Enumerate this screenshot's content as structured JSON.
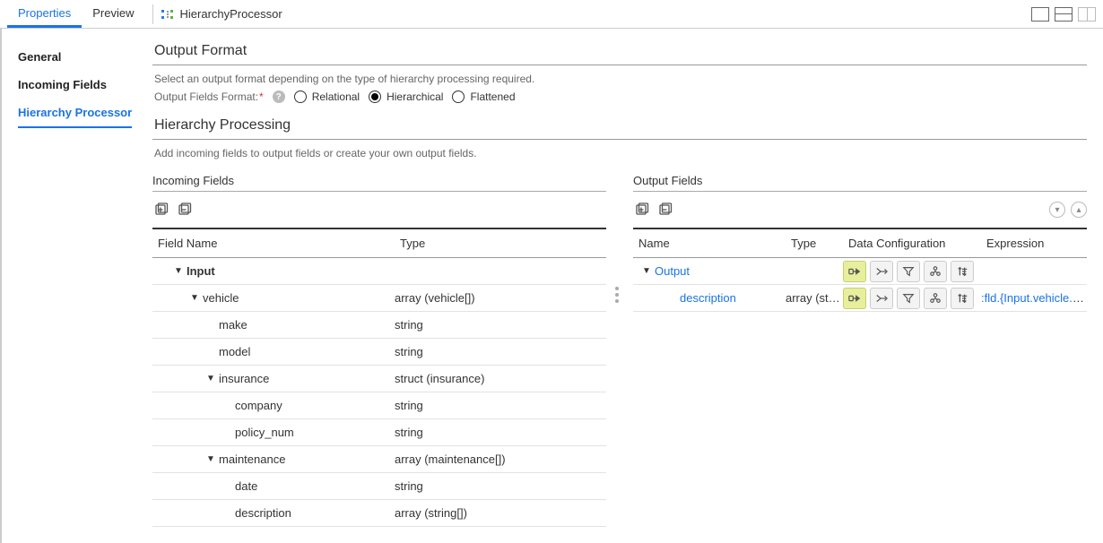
{
  "topTabs": {
    "properties": "Properties",
    "preview": "Preview"
  },
  "processorLabel": "HierarchyProcessor",
  "sidebar": {
    "general": "General",
    "incoming": "Incoming Fields",
    "hp": "Hierarchy Processor"
  },
  "outputFormat": {
    "title": "Output Format",
    "sub": "Select an output format depending on the type of hierarchy processing required.",
    "fieldsFormatLabel": "Output Fields Format:",
    "relational": "Relational",
    "hierarchical": "Hierarchical",
    "flattened": "Flattened"
  },
  "hpSection": {
    "title": "Hierarchy Processing",
    "sub": "Add incoming fields to output fields or create your own output fields."
  },
  "incoming": {
    "heading": "Incoming Fields",
    "colField": "Field Name",
    "colType": "Type",
    "rows": [
      {
        "name": "Input",
        "type": "",
        "level": 0,
        "caret": true,
        "bold": true
      },
      {
        "name": "vehicle",
        "type": "array (vehicle[])",
        "level": 1,
        "caret": true
      },
      {
        "name": "make",
        "type": "string",
        "level": 2
      },
      {
        "name": "model",
        "type": "string",
        "level": 2
      },
      {
        "name": "insurance",
        "type": "struct (insurance)",
        "level": 2,
        "caret": true
      },
      {
        "name": "company",
        "type": "string",
        "level": 3
      },
      {
        "name": "policy_num",
        "type": "string",
        "level": 3
      },
      {
        "name": "maintenance",
        "type": "array (maintenance[])",
        "level": 2,
        "caret": true
      },
      {
        "name": "date",
        "type": "string",
        "level": 3
      },
      {
        "name": "description",
        "type": "array (string[])",
        "level": 3
      }
    ]
  },
  "output": {
    "heading": "Output Fields",
    "colName": "Name",
    "colType": "Type",
    "colData": "Data Configuration",
    "colExpr": "Expression",
    "rows": [
      {
        "name": "Output",
        "type": "",
        "expr": "",
        "level": 0,
        "caret": true,
        "hl": true
      },
      {
        "name": "description",
        "type": "array (str…",
        "expr": ":fld.{Input.vehicle.vel",
        "level": 1,
        "hl": true
      }
    ]
  }
}
